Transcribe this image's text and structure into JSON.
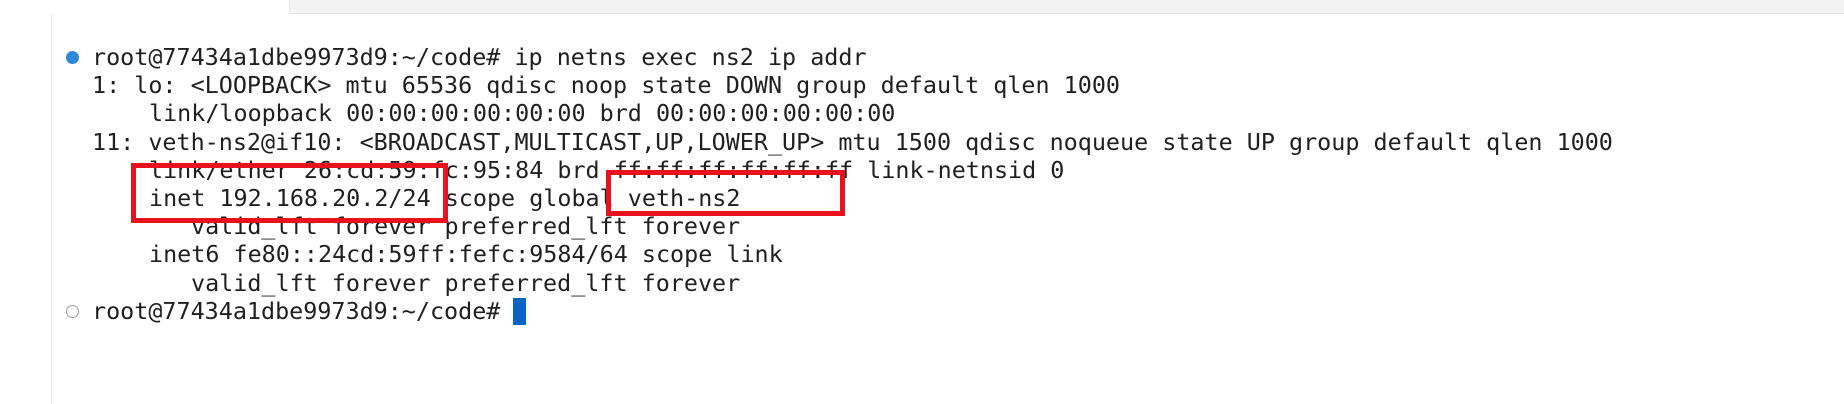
{
  "terminal": {
    "lines": [
      "root@77434a1dbe9973d9:~/code# ip netns exec ns2 ip addr",
      "1: lo: <LOOPBACK> mtu 65536 qdisc noop state DOWN group default qlen 1000",
      "link/loopback 00:00:00:00:00:00 brd 00:00:00:00:00:00",
      "11: veth-ns2@if10: <BROADCAST,MULTICAST,UP,LOWER_UP> mtu 1500 qdisc noqueue state UP group default qlen 1000",
      "link/ether 26:cd:59:fc:95:84 brd ff:ff:ff:ff:ff:ff link-netnsid 0",
      "inet 192.168.20.2/24 scope global veth-ns2",
      "valid_lft forever preferred_lft forever",
      "inet6 fe80::24cd:59ff:fefc:9584/64 scope link",
      "valid_lft forever preferred_lft forever",
      "root@77434a1dbe9973d9:~/code# "
    ]
  },
  "colors": {
    "highlight": "#e8121e",
    "cursor": "#0b63c5",
    "success_dot": "#2f87d8"
  }
}
